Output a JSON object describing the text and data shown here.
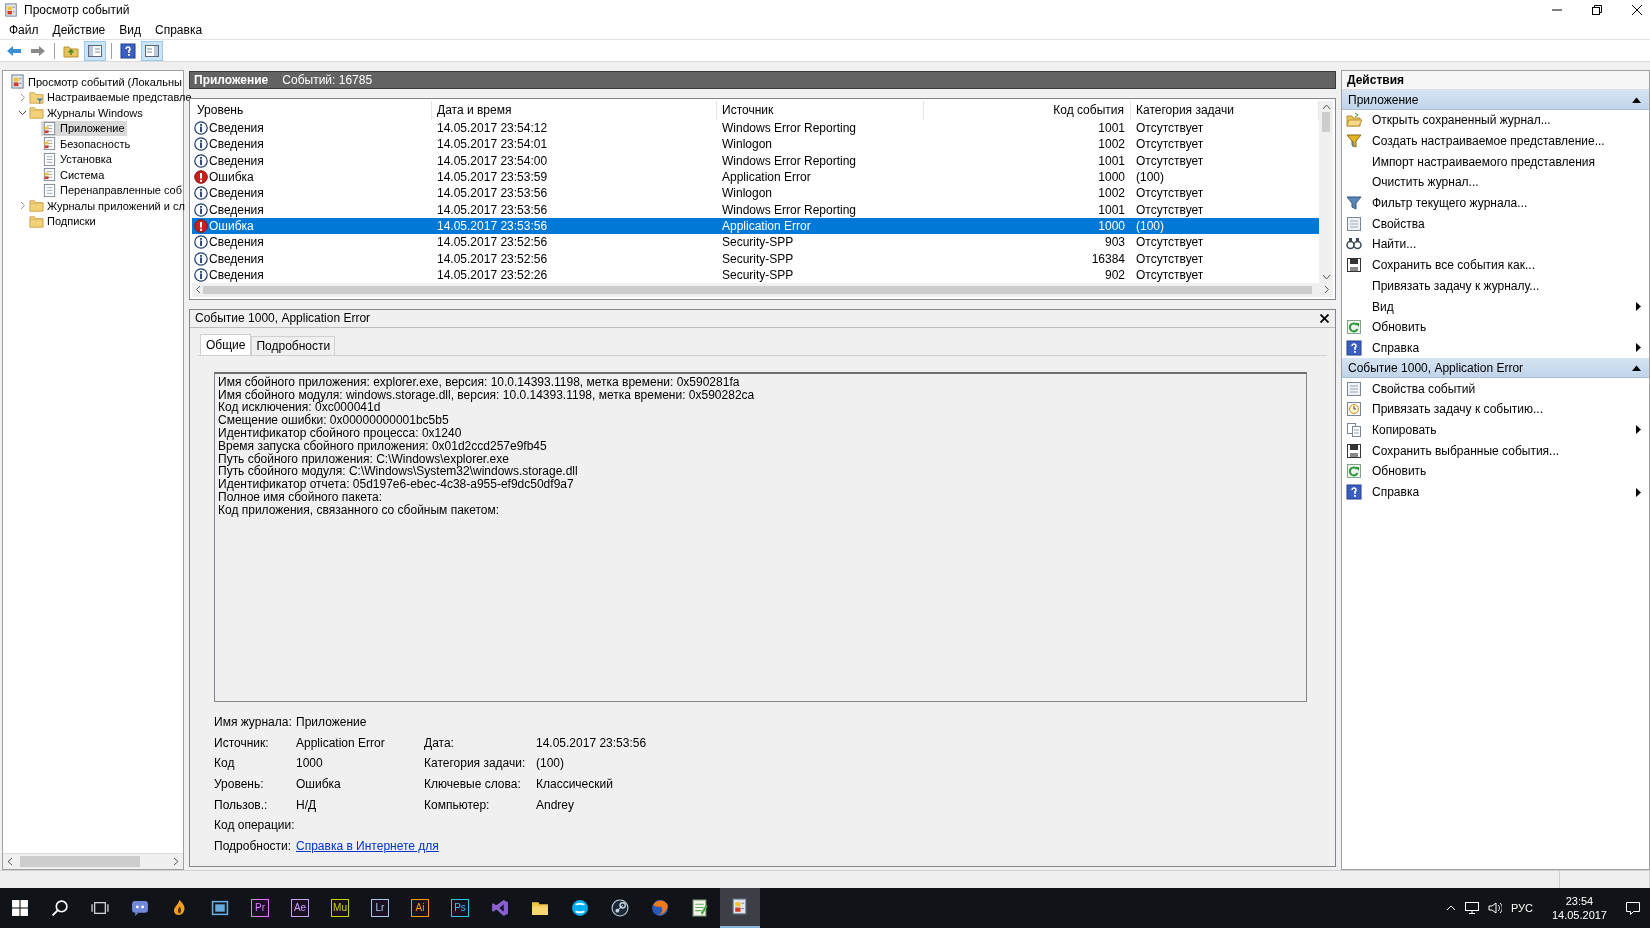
{
  "window": {
    "title": "Просмотр событий"
  },
  "menu": [
    "Файл",
    "Действие",
    "Вид",
    "Справка"
  ],
  "toolbar": [
    {
      "kind": "back",
      "pressed": false
    },
    {
      "kind": "forward",
      "pressed": false
    },
    {
      "kind": "separator"
    },
    {
      "kind": "up-folder",
      "pressed": false
    },
    {
      "kind": "tree-pane",
      "pressed": true
    },
    {
      "kind": "separator"
    },
    {
      "kind": "help",
      "pressed": false
    },
    {
      "kind": "action-pane",
      "pressed": true
    }
  ],
  "tree": [
    {
      "label": "Просмотр событий (Локальны",
      "kind": "viewer",
      "selected": false,
      "children": [
        {
          "label": "Настраиваемые представле",
          "kind": "filter-folder",
          "expanded": false,
          "selected": false
        },
        {
          "label": "Журналы Windows",
          "kind": "folder",
          "expanded": true,
          "selected": false,
          "children": [
            {
              "label": "Приложение",
              "kind": "log",
              "selected": true
            },
            {
              "label": "Безопасность",
              "kind": "log",
              "selected": false
            },
            {
              "label": "Установка",
              "kind": "plain-log",
              "selected": false
            },
            {
              "label": "Система",
              "kind": "log",
              "selected": false
            },
            {
              "label": "Перенаправленные соб",
              "kind": "plain-log",
              "selected": false
            }
          ]
        },
        {
          "label": "Журналы приложений и сл",
          "kind": "folder",
          "expanded": false,
          "selected": false
        },
        {
          "label": "Подписки",
          "kind": "folder",
          "selected": false
        }
      ]
    }
  ],
  "log_header": {
    "title": "Приложение",
    "count": "Событий: 16785"
  },
  "events": {
    "columns": [
      "Уровень",
      "Дата и время",
      "Источник",
      "Код события",
      "Категория задачи"
    ],
    "rows": [
      {
        "kind": "info",
        "severity": "Сведения",
        "date": "14.05.2017 23:54:12",
        "source": "Windows Error Reporting",
        "code": "1001",
        "category": "Отсутствует",
        "selected": false
      },
      {
        "kind": "info",
        "severity": "Сведения",
        "date": "14.05.2017 23:54:01",
        "source": "Winlogon",
        "code": "1002",
        "category": "Отсутствует",
        "selected": false
      },
      {
        "kind": "info",
        "severity": "Сведения",
        "date": "14.05.2017 23:54:00",
        "source": "Windows Error Reporting",
        "code": "1001",
        "category": "Отсутствует",
        "selected": false
      },
      {
        "kind": "error",
        "severity": "Ошибка",
        "date": "14.05.2017 23:53:59",
        "source": "Application Error",
        "code": "1000",
        "category": "(100)",
        "selected": false
      },
      {
        "kind": "info",
        "severity": "Сведения",
        "date": "14.05.2017 23:53:56",
        "source": "Winlogon",
        "code": "1002",
        "category": "Отсутствует",
        "selected": false
      },
      {
        "kind": "info",
        "severity": "Сведения",
        "date": "14.05.2017 23:53:56",
        "source": "Windows Error Reporting",
        "code": "1001",
        "category": "Отсутствует",
        "selected": false
      },
      {
        "kind": "error",
        "severity": "Ошибка",
        "date": "14.05.2017 23:53:56",
        "source": "Application Error",
        "code": "1000",
        "category": "(100)",
        "selected": true
      },
      {
        "kind": "info",
        "severity": "Сведения",
        "date": "14.05.2017 23:52:56",
        "source": "Security-SPP",
        "code": "903",
        "category": "Отсутствует",
        "selected": false
      },
      {
        "kind": "info",
        "severity": "Сведения",
        "date": "14.05.2017 23:52:56",
        "source": "Security-SPP",
        "code": "16384",
        "category": "Отсутствует",
        "selected": false
      },
      {
        "kind": "info",
        "severity": "Сведения",
        "date": "14.05.2017 23:52:26",
        "source": "Security-SPP",
        "code": "902",
        "category": "Отсутствует",
        "selected": false
      }
    ]
  },
  "details": {
    "title": "Событие 1000, Application Error",
    "tabs": [
      {
        "label": "Общие",
        "selected": true
      },
      {
        "label": "Подробности",
        "selected": false
      }
    ],
    "description": [
      "Имя сбойного приложения: explorer.exe, версия: 10.0.14393.1198, метка времени: 0x590281fa",
      "Имя сбойного модуля: windows.storage.dll, версия: 10.0.14393.1198, метка времени: 0x590282ca",
      "Код исключения: 0xc000041d",
      "Смещение ошибки: 0x00000000001bc5b5",
      "Идентификатор сбойного процесса: 0x1240",
      "Время запуска сбойного приложения: 0x01d2ccd257e9fb45",
      "Путь сбойного приложения: C:\\Windows\\explorer.exe",
      "Путь сбойного модуля: C:\\Windows\\System32\\windows.storage.dll",
      "Идентификатор отчета: 05d197e6-ebec-4c38-a955-ef9dc50df9a7",
      "Полное имя сбойного пакета:",
      "Код приложения, связанного со сбойным пакетом:"
    ],
    "fields": [
      {
        "left": {
          "label": "Имя журнала:",
          "value": "Приложение"
        }
      },
      {
        "left": {
          "label": "Источник:",
          "value": "Application Error"
        },
        "right": {
          "label": "Дата:",
          "value": "14.05.2017 23:53:56"
        }
      },
      {
        "left": {
          "label": "Код",
          "value": "1000"
        },
        "right": {
          "label": "Категория задачи:",
          "value": "(100)"
        }
      },
      {
        "left": {
          "label": "Уровень:",
          "value": "Ошибка"
        },
        "right": {
          "label": "Ключевые слова:",
          "value": "Классический"
        }
      },
      {
        "left": {
          "label": "Пользов.:",
          "value": "Н/Д"
        },
        "right": {
          "label": "Компьютер:",
          "value": "Andrey"
        }
      },
      {
        "left": {
          "label": "Код операции:"
        }
      },
      {
        "left": {
          "label": "Подробности:",
          "link": "Справка в Интернете для"
        }
      }
    ]
  },
  "actions": {
    "title": "Действия",
    "sections": [
      {
        "title": "Приложение",
        "expanded": true,
        "items": [
          {
            "kind": "open-folder",
            "label": "Открыть сохраненный журнал...",
            "submenu": false
          },
          {
            "kind": "new-filter",
            "label": "Создать настраиваемое представление...",
            "submenu": false
          },
          {
            "kind": "plain",
            "label": "Импорт настраиваемого представления",
            "submenu": false
          },
          {
            "kind": "plain",
            "label": "Очистить журнал...",
            "submenu": false
          },
          {
            "kind": "filter",
            "label": "Фильтр текущего журнала...",
            "submenu": false
          },
          {
            "kind": "properties",
            "label": "Свойства",
            "submenu": false
          },
          {
            "kind": "find",
            "label": "Найти...",
            "submenu": false
          },
          {
            "kind": "save",
            "label": "Сохранить все события как...",
            "submenu": false
          },
          {
            "kind": "plain",
            "label": "Привязать задачу к журналу...",
            "submenu": false
          },
          {
            "kind": "plain",
            "label": "Вид",
            "submenu": true
          },
          {
            "kind": "refresh",
            "label": "Обновить",
            "submenu": false
          },
          {
            "kind": "help",
            "label": "Справка",
            "submenu": true
          }
        ]
      },
      {
        "title": "Событие 1000, Application Error",
        "expanded": true,
        "items": [
          {
            "kind": "properties",
            "label": "Свойства событий",
            "submenu": false
          },
          {
            "kind": "task",
            "label": "Привязать задачу к событию...",
            "submenu": false
          },
          {
            "kind": "copy",
            "label": "Копировать",
            "submenu": true
          },
          {
            "kind": "save",
            "label": "Сохранить выбранные события...",
            "submenu": false
          },
          {
            "kind": "refresh",
            "label": "Обновить",
            "submenu": false
          },
          {
            "kind": "help",
            "label": "Справка",
            "submenu": true
          }
        ]
      }
    ]
  },
  "taskbar": {
    "items": [
      {
        "kind": "start",
        "selected": false
      },
      {
        "kind": "search",
        "selected": false
      },
      {
        "kind": "task-view",
        "selected": false
      },
      {
        "kind": "chat",
        "selected": false
      },
      {
        "kind": "flame",
        "selected": false
      },
      {
        "kind": "film",
        "selected": false
      },
      {
        "kind": "tile",
        "label": "Pr",
        "color": "#e77bff",
        "selected": false
      },
      {
        "kind": "tile",
        "label": "Ae",
        "color": "#c9a0ff",
        "selected": false
      },
      {
        "kind": "tile",
        "label": "Mu",
        "color": "#c8d400",
        "selected": false
      },
      {
        "kind": "tile",
        "label": "Lr",
        "color": "#a8c8ee",
        "selected": false
      },
      {
        "kind": "tile",
        "label": "Ai",
        "color": "#ff9a00",
        "selected": false
      },
      {
        "kind": "tile",
        "label": "Ps",
        "color": "#31c5f0",
        "selected": false
      },
      {
        "kind": "studio",
        "selected": false
      },
      {
        "kind": "folder",
        "selected": false
      },
      {
        "kind": "phone",
        "selected": false
      },
      {
        "kind": "gears",
        "selected": false
      },
      {
        "kind": "globe",
        "selected": false
      },
      {
        "kind": "notepad",
        "selected": false
      },
      {
        "kind": "viewer",
        "selected": true
      }
    ],
    "language": "РУС",
    "time": "23:54",
    "date": "14.05.2017"
  }
}
